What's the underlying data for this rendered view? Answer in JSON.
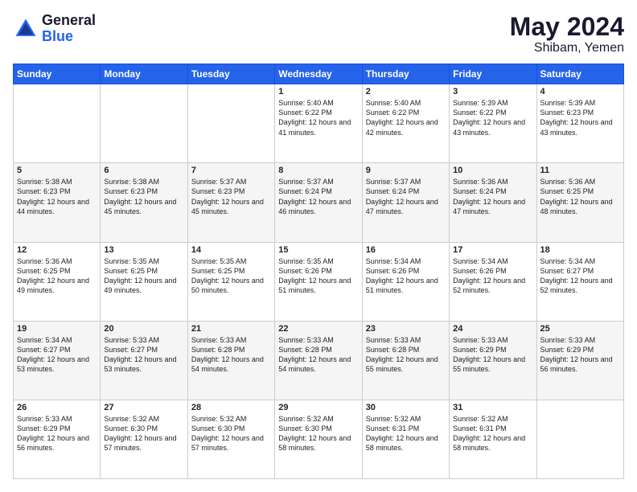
{
  "header": {
    "logo_general": "General",
    "logo_blue": "Blue",
    "month_year": "May 2024",
    "location": "Shibam, Yemen"
  },
  "days_of_week": [
    "Sunday",
    "Monday",
    "Tuesday",
    "Wednesday",
    "Thursday",
    "Friday",
    "Saturday"
  ],
  "weeks": [
    [
      {
        "day": "",
        "info": ""
      },
      {
        "day": "",
        "info": ""
      },
      {
        "day": "",
        "info": ""
      },
      {
        "day": "1",
        "info": "Sunrise: 5:40 AM\nSunset: 6:22 PM\nDaylight: 12 hours\nand 41 minutes."
      },
      {
        "day": "2",
        "info": "Sunrise: 5:40 AM\nSunset: 6:22 PM\nDaylight: 12 hours\nand 42 minutes."
      },
      {
        "day": "3",
        "info": "Sunrise: 5:39 AM\nSunset: 6:22 PM\nDaylight: 12 hours\nand 43 minutes."
      },
      {
        "day": "4",
        "info": "Sunrise: 5:39 AM\nSunset: 6:23 PM\nDaylight: 12 hours\nand 43 minutes."
      }
    ],
    [
      {
        "day": "5",
        "info": "Sunrise: 5:38 AM\nSunset: 6:23 PM\nDaylight: 12 hours\nand 44 minutes."
      },
      {
        "day": "6",
        "info": "Sunrise: 5:38 AM\nSunset: 6:23 PM\nDaylight: 12 hours\nand 45 minutes."
      },
      {
        "day": "7",
        "info": "Sunrise: 5:37 AM\nSunset: 6:23 PM\nDaylight: 12 hours\nand 45 minutes."
      },
      {
        "day": "8",
        "info": "Sunrise: 5:37 AM\nSunset: 6:24 PM\nDaylight: 12 hours\nand 46 minutes."
      },
      {
        "day": "9",
        "info": "Sunrise: 5:37 AM\nSunset: 6:24 PM\nDaylight: 12 hours\nand 47 minutes."
      },
      {
        "day": "10",
        "info": "Sunrise: 5:36 AM\nSunset: 6:24 PM\nDaylight: 12 hours\nand 47 minutes."
      },
      {
        "day": "11",
        "info": "Sunrise: 5:36 AM\nSunset: 6:25 PM\nDaylight: 12 hours\nand 48 minutes."
      }
    ],
    [
      {
        "day": "12",
        "info": "Sunrise: 5:36 AM\nSunset: 6:25 PM\nDaylight: 12 hours\nand 49 minutes."
      },
      {
        "day": "13",
        "info": "Sunrise: 5:35 AM\nSunset: 6:25 PM\nDaylight: 12 hours\nand 49 minutes."
      },
      {
        "day": "14",
        "info": "Sunrise: 5:35 AM\nSunset: 6:25 PM\nDaylight: 12 hours\nand 50 minutes."
      },
      {
        "day": "15",
        "info": "Sunrise: 5:35 AM\nSunset: 6:26 PM\nDaylight: 12 hours\nand 51 minutes."
      },
      {
        "day": "16",
        "info": "Sunrise: 5:34 AM\nSunset: 6:26 PM\nDaylight: 12 hours\nand 51 minutes."
      },
      {
        "day": "17",
        "info": "Sunrise: 5:34 AM\nSunset: 6:26 PM\nDaylight: 12 hours\nand 52 minutes."
      },
      {
        "day": "18",
        "info": "Sunrise: 5:34 AM\nSunset: 6:27 PM\nDaylight: 12 hours\nand 52 minutes."
      }
    ],
    [
      {
        "day": "19",
        "info": "Sunrise: 5:34 AM\nSunset: 6:27 PM\nDaylight: 12 hours\nand 53 minutes."
      },
      {
        "day": "20",
        "info": "Sunrise: 5:33 AM\nSunset: 6:27 PM\nDaylight: 12 hours\nand 53 minutes."
      },
      {
        "day": "21",
        "info": "Sunrise: 5:33 AM\nSunset: 6:28 PM\nDaylight: 12 hours\nand 54 minutes."
      },
      {
        "day": "22",
        "info": "Sunrise: 5:33 AM\nSunset: 6:28 PM\nDaylight: 12 hours\nand 54 minutes."
      },
      {
        "day": "23",
        "info": "Sunrise: 5:33 AM\nSunset: 6:28 PM\nDaylight: 12 hours\nand 55 minutes."
      },
      {
        "day": "24",
        "info": "Sunrise: 5:33 AM\nSunset: 6:29 PM\nDaylight: 12 hours\nand 55 minutes."
      },
      {
        "day": "25",
        "info": "Sunrise: 5:33 AM\nSunset: 6:29 PM\nDaylight: 12 hours\nand 56 minutes."
      }
    ],
    [
      {
        "day": "26",
        "info": "Sunrise: 5:33 AM\nSunset: 6:29 PM\nDaylight: 12 hours\nand 56 minutes."
      },
      {
        "day": "27",
        "info": "Sunrise: 5:32 AM\nSunset: 6:30 PM\nDaylight: 12 hours\nand 57 minutes."
      },
      {
        "day": "28",
        "info": "Sunrise: 5:32 AM\nSunset: 6:30 PM\nDaylight: 12 hours\nand 57 minutes."
      },
      {
        "day": "29",
        "info": "Sunrise: 5:32 AM\nSunset: 6:30 PM\nDaylight: 12 hours\nand 58 minutes."
      },
      {
        "day": "30",
        "info": "Sunrise: 5:32 AM\nSunset: 6:31 PM\nDaylight: 12 hours\nand 58 minutes."
      },
      {
        "day": "31",
        "info": "Sunrise: 5:32 AM\nSunset: 6:31 PM\nDaylight: 12 hours\nand 58 minutes."
      },
      {
        "day": "",
        "info": ""
      }
    ]
  ]
}
